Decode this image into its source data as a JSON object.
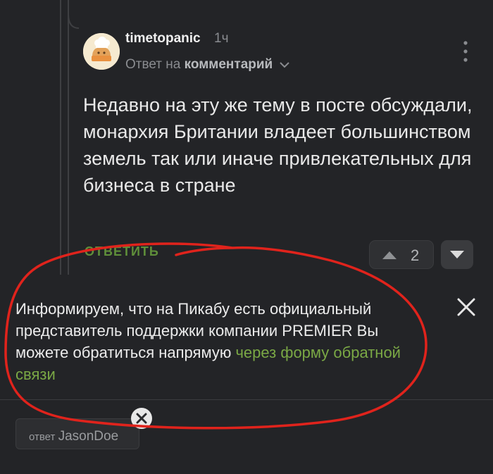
{
  "comment": {
    "username": "timetopanic",
    "time": "1ч",
    "reply_prefix": "Ответ на",
    "reply_target": "комментарий",
    "text": "Недавно на эту же тему в посте обсуждали, монархия Британии владеет большинством земель так или иначе привлекательных для бизнеса в стране",
    "reply_label": "ОТВЕТИТЬ",
    "rating": "2"
  },
  "notice": {
    "text": "Информируем, что на Пикабу есть официальный представитель поддержки компании PREMIER  Вы можете обратиться напрямую ",
    "link_text": "через форму обратной связи"
  },
  "reply_chip": {
    "prefix": "ответ",
    "name": "JasonDoe"
  },
  "colors": {
    "background": "#232427",
    "link_green": "#7aa845",
    "annotation_red": "#e0231c"
  },
  "icons": [
    "chef-avatar-icon",
    "chevron-down-icon",
    "more-vertical-icon",
    "arrow-up-icon",
    "arrow-down-icon",
    "close-icon"
  ]
}
